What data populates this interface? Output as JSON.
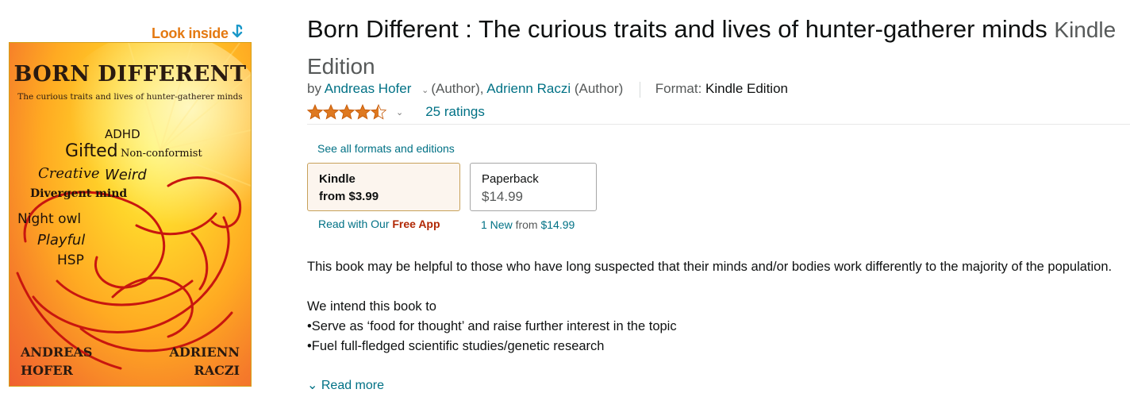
{
  "look_inside": {
    "label": "Look inside",
    "arrow_icon": "curved-down-arrow-icon"
  },
  "cover": {
    "title": "BORN DIFFERENT",
    "subtitle": "The curious traits and lives of hunter-gatherer minds",
    "words": [
      "ADHD",
      "Gifted",
      "Non-conformist",
      "Creative",
      "Weird",
      "Divergent mind",
      "Night owl",
      "Playful",
      "HSP"
    ],
    "author_left": [
      "ANDREAS",
      "HOFER"
    ],
    "author_right": [
      "ADRIENN",
      "RACZI"
    ]
  },
  "product": {
    "title": "Born Different : The curious traits and lives of hunter-gatherer minds",
    "edition": "Kindle Edition",
    "byline": {
      "by": "by",
      "author1": "Andreas Hofer",
      "author1_role": "(Author),",
      "author2": "Adrienn Raczi",
      "author2_role": "(Author)",
      "format_label": "Format:",
      "format_value": "Kindle Edition"
    },
    "rating": {
      "stars": 4.5,
      "count_label": "25 ratings",
      "star_color": "#de7921"
    }
  },
  "formats": {
    "see_all": "See all formats and editions",
    "kindle": {
      "name": "Kindle",
      "price": "from $3.99",
      "footer_prefix": "Read with Our",
      "footer_free": "Free App"
    },
    "paperback": {
      "name": "Paperback",
      "price": "$14.99",
      "footer_count": "1 New",
      "footer_from": "from",
      "footer_price": "$14.99"
    }
  },
  "description": {
    "para1": "This book may be helpful to those who have long suspected that their minds and/or bodies work differently to the majority of the population.",
    "para2": "We intend this book to",
    "bullet1": "•Serve as ‘food for thought’ and raise further interest in the topic",
    "bullet2": "•Fuel full-fledged scientific studies/genetic research",
    "read_more": "Read more"
  },
  "colors": {
    "link": "#007185",
    "free_app": "#b12704",
    "look_inside": "#e47911"
  }
}
